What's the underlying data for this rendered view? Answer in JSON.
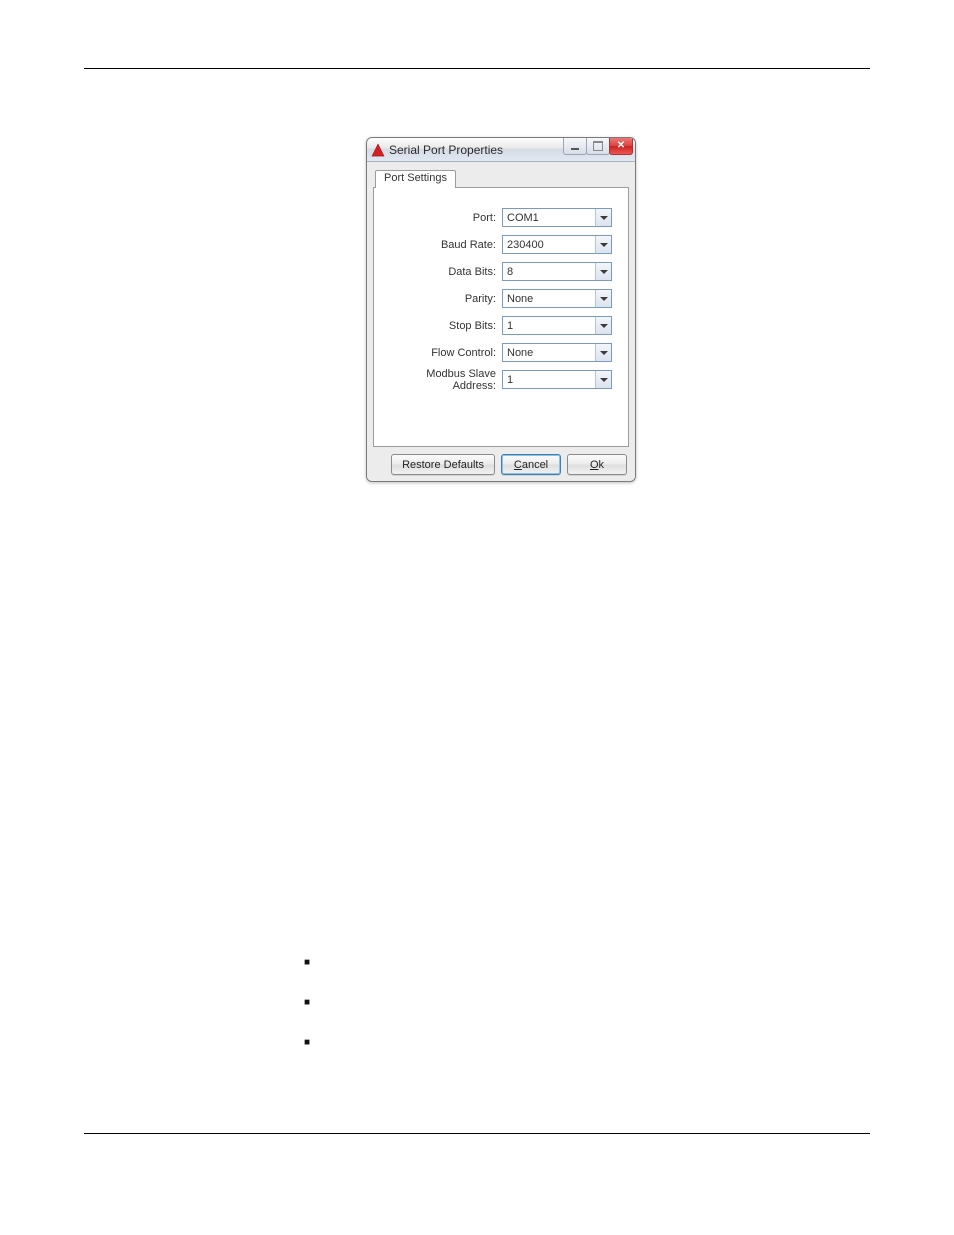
{
  "window": {
    "title": "Serial Port Properties"
  },
  "tabs": {
    "port_settings": "Port Settings"
  },
  "fields": {
    "port": {
      "label": "Port:",
      "value": "COM1"
    },
    "baud": {
      "label": "Baud Rate:",
      "value": "230400"
    },
    "databits": {
      "label": "Data Bits:",
      "value": "8"
    },
    "parity": {
      "label": "Parity:",
      "value": "None"
    },
    "stopbits": {
      "label": "Stop Bits:",
      "value": "1"
    },
    "flow": {
      "label": "Flow Control:",
      "value": "None"
    },
    "modbus": {
      "label": "Modbus Slave Address:",
      "value": "1"
    }
  },
  "buttons": {
    "restore": "Restore Defaults",
    "cancel_pre": "",
    "cancel_u": "C",
    "cancel_post": "ancel",
    "ok_u": "O",
    "ok_post": "k"
  }
}
